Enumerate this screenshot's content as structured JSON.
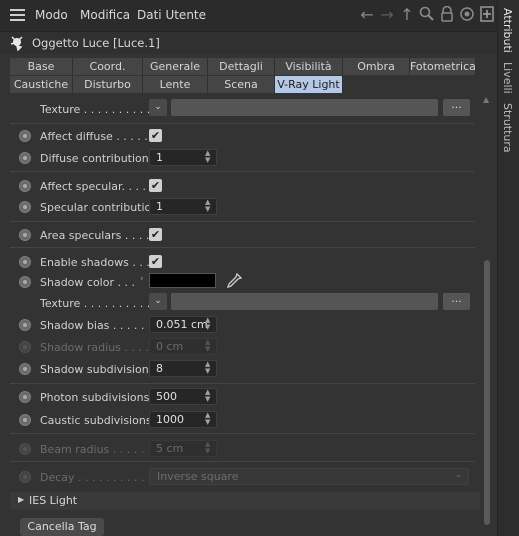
{
  "menubar": {
    "items": [
      "Modo",
      "Modifica",
      "Dati Utente"
    ]
  },
  "object": {
    "title": "Oggetto Luce [Luce.1]"
  },
  "tabs": {
    "row1": [
      "Base",
      "Coord.",
      "Generale",
      "Dettagli",
      "Visibilità",
      "Ombra",
      "Fotometrica"
    ],
    "row2": [
      "Caustiche",
      "Disturbo",
      "Lente",
      "Scena",
      "V-Ray Light"
    ],
    "active": "V-Ray Light"
  },
  "sidebar": {
    "tabs": [
      "Attributi",
      "Livelli",
      "Struttura"
    ]
  },
  "params": {
    "texture1_label": "Texture . . . . . . . . . . .",
    "texture_button": "...",
    "affect_diffuse": "Affect diffuse . . . . . .",
    "diffuse_contribution": "Diffuse contribution",
    "diffuse_contribution_value": "1",
    "affect_specular": "Affect specular. . . . .",
    "specular_contribution": "Specular contribution",
    "specular_contribution_value": "1",
    "area_speculars": "Area speculars . . . . .",
    "enable_shadows": "Enable shadows . . . .",
    "shadow_color": "Shadow color . . .",
    "texture2_label": "Texture . . . . . . . . . . .",
    "shadow_bias": "Shadow bias . . . . . .",
    "shadow_bias_value": "0.051 cm",
    "shadow_radius": "Shadow radius . . . . .",
    "shadow_radius_value": "0 cm",
    "shadow_subdivisions": "Shadow subdivisions",
    "shadow_subdivisions_value": "8",
    "photon_subdivisions": "Photon subdivisions",
    "photon_subdivisions_value": "500",
    "caustic_subdivisions": "Caustic subdivisions",
    "caustic_subdivisions_value": "1000",
    "beam_radius": "Beam radius . . . . . .",
    "beam_radius_value": "5 cm",
    "decay": "Decay . . . . . . . . . . .",
    "decay_value": "Inverse square",
    "ies_light": "IES Light",
    "check_mark": "✔"
  },
  "footer": {
    "remove_tag": "Cancella Tag"
  },
  "colors": {
    "active_tab": "#b5c9e6",
    "shadow_color": "#000000"
  }
}
